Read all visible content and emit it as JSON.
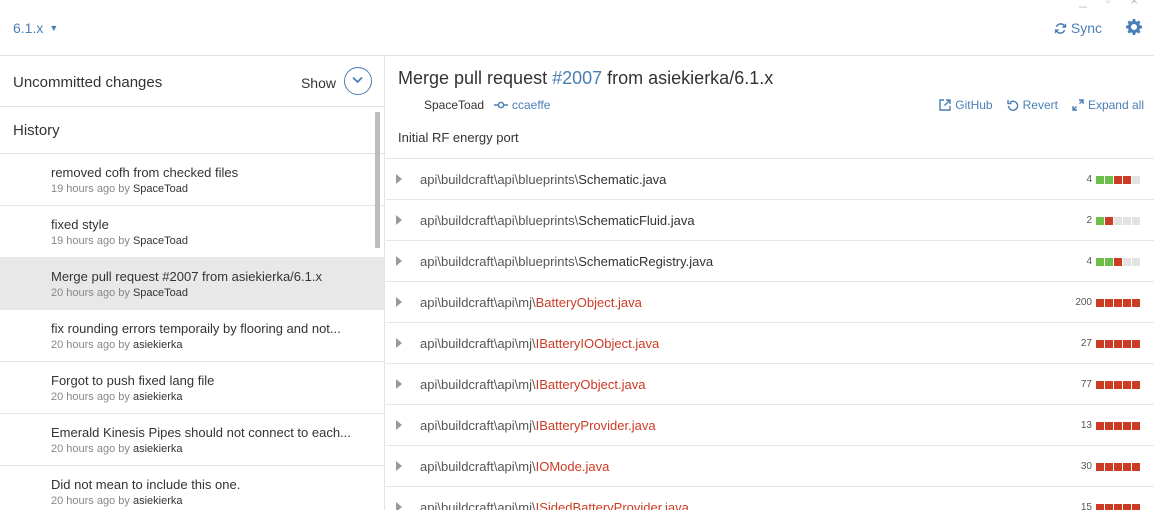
{
  "header": {
    "branch": "6.1.x",
    "sync_label": "Sync",
    "icons": {
      "sync": "sync-icon",
      "settings": "gear-icon"
    }
  },
  "sidebar": {
    "uncommitted_label": "Uncommitted changes",
    "show_label": "Show",
    "history_label": "History",
    "commits": [
      {
        "message": "removed cofh from checked files",
        "time": "19 hours ago",
        "by": "by",
        "author": "SpaceToad"
      },
      {
        "message": "fixed style",
        "time": "19 hours ago",
        "by": "by",
        "author": "SpaceToad"
      },
      {
        "message": "Merge pull request #2007 from asiekierka/6.1.x",
        "time": "20 hours ago",
        "by": "by",
        "author": "SpaceToad"
      },
      {
        "message": "fix rounding errors temporaily by flooring and not...",
        "time": "20 hours ago",
        "by": "by",
        "author": "asiekierka"
      },
      {
        "message": "Forgot to push fixed lang file",
        "time": "20 hours ago",
        "by": "by",
        "author": "asiekierka"
      },
      {
        "message": "Emerald Kinesis Pipes should not connect to each...",
        "time": "20 hours ago",
        "by": "by",
        "author": "asiekierka"
      },
      {
        "message": "Did not mean to include this one.",
        "time": "20 hours ago",
        "by": "by",
        "author": "asiekierka"
      }
    ]
  },
  "detail": {
    "title_prefix": "Merge pull request ",
    "pr_number": "#2007",
    "title_suffix": " from asiekierka/6.1.x",
    "author": "SpaceToad",
    "sha": "ccaeffe",
    "actions": {
      "github": "GitHub",
      "revert": "Revert",
      "expand": "Expand all"
    },
    "description": "Initial RF energy port",
    "files": [
      {
        "dir": "api\\buildcraft\\api\\blueprints\\",
        "name": "Schematic.java",
        "added_file": false,
        "count": "4",
        "bars": [
          "g",
          "g",
          "r",
          "r",
          "n"
        ]
      },
      {
        "dir": "api\\buildcraft\\api\\blueprints\\",
        "name": "SchematicFluid.java",
        "added_file": false,
        "count": "2",
        "bars": [
          "g",
          "r",
          "n",
          "n",
          "n"
        ]
      },
      {
        "dir": "api\\buildcraft\\api\\blueprints\\",
        "name": "SchematicRegistry.java",
        "added_file": false,
        "count": "4",
        "bars": [
          "g",
          "g",
          "r",
          "n",
          "n"
        ]
      },
      {
        "dir": "api\\buildcraft\\api\\mj\\",
        "name": "BatteryObject.java",
        "added_file": true,
        "count": "200",
        "bars": [
          "r",
          "r",
          "r",
          "r",
          "r"
        ]
      },
      {
        "dir": "api\\buildcraft\\api\\mj\\",
        "name": "IBatteryIOObject.java",
        "added_file": true,
        "count": "27",
        "bars": [
          "r",
          "r",
          "r",
          "r",
          "r"
        ]
      },
      {
        "dir": "api\\buildcraft\\api\\mj\\",
        "name": "IBatteryObject.java",
        "added_file": true,
        "count": "77",
        "bars": [
          "r",
          "r",
          "r",
          "r",
          "r"
        ]
      },
      {
        "dir": "api\\buildcraft\\api\\mj\\",
        "name": "IBatteryProvider.java",
        "added_file": true,
        "count": "13",
        "bars": [
          "r",
          "r",
          "r",
          "r",
          "r"
        ]
      },
      {
        "dir": "api\\buildcraft\\api\\mj\\",
        "name": "IOMode.java",
        "added_file": true,
        "count": "30",
        "bars": [
          "r",
          "r",
          "r",
          "r",
          "r"
        ]
      },
      {
        "dir": "api\\buildcraft\\api\\mj\\",
        "name": "ISidedBatteryProvider.java",
        "added_file": true,
        "count": "15",
        "bars": [
          "r",
          "r",
          "r",
          "r",
          "r"
        ]
      }
    ]
  },
  "colors": {
    "accent": "#4a7fb5",
    "added": "#6cc04a",
    "deleted": "#cc3b24",
    "selected_bg": "#e8e8e8"
  }
}
